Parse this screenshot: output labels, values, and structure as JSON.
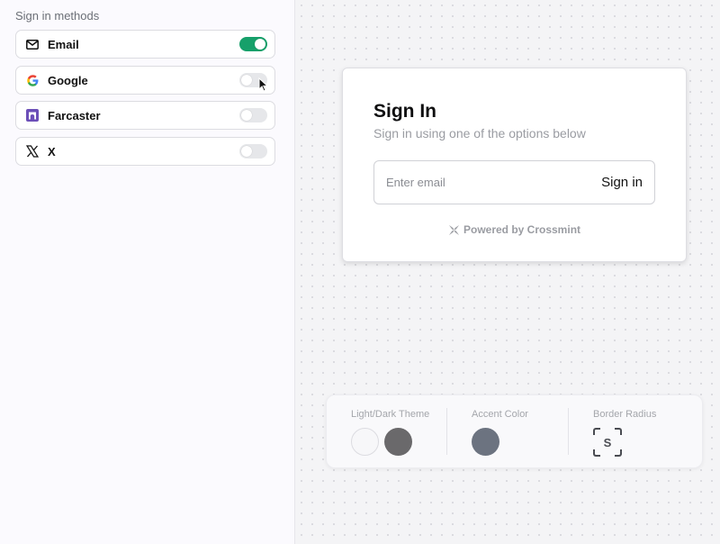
{
  "sidebar": {
    "title": "Sign in methods",
    "methods": [
      {
        "label": "Email",
        "icon": "mail-icon",
        "enabled": true
      },
      {
        "label": "Google",
        "icon": "google-icon",
        "enabled": false
      },
      {
        "label": "Farcaster",
        "icon": "farcaster-icon",
        "enabled": false
      },
      {
        "label": "X",
        "icon": "x-icon",
        "enabled": false
      }
    ]
  },
  "signin": {
    "title": "Sign In",
    "subtitle": "Sign in using one of the options below",
    "email_placeholder": "Enter email",
    "button_label": "Sign in",
    "powered_by": "Powered by Crossmint"
  },
  "theme_panel": {
    "theme_label": "Light/Dark Theme",
    "accent_label": "Accent Color",
    "radius_label": "Border Radius",
    "radius_value": "S",
    "theme_options": [
      "#f7f7f9",
      "#6a696b"
    ],
    "accent_color": "#6c7380"
  },
  "colors": {
    "toggle_on": "#16a06a",
    "toggle_off": "#e6e7ea",
    "farcaster": "#6c4fb8"
  }
}
